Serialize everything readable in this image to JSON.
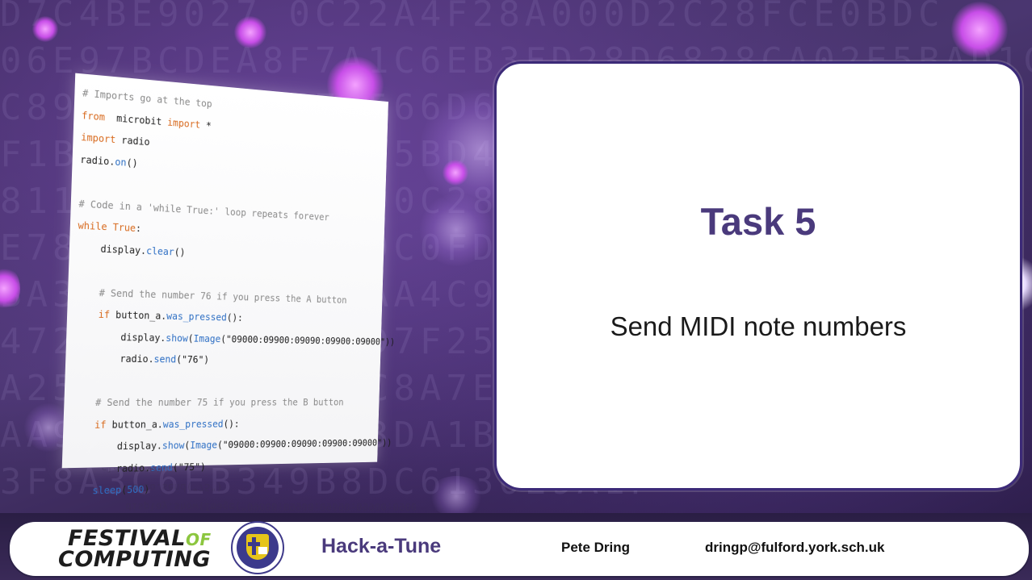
{
  "background": {
    "hex_rows": [
      "D7C4BE9027 0C22A4F28A000D2C28FCE0BDC",
      "06E97BCDEA8F7A1C6EB3FD28D6828CA02E5BAD1C6",
      "C89FB20D19A672566D6F9A9CCCCCA95DEB9AC",
      "F1BA63A2D7C4E585BD4F9A51A3CE67E11BB0",
      "811A5E62B0F1E9D0C28A8D9E2BC0F4A1",
      "E786F2B77C4A9D9C0FD3D2C8B6A4E8F",
      "BA3EA8B7D9E8B3AA4C9EB1F0C2DAE8",
      "472B8E3F9BD2A8D7F251ED9A8C6E2",
      "A25B4FC74EBA82C8A7E9C3B1A0D",
      "AA9B4F3F8C0E9D3DA1B2C6B4E",
      "3F8A3C6EB349B8DC6130E9A1F"
    ],
    "colors": {
      "bg_top": "#3c2a5c",
      "bg_bottom": "#1c1230",
      "orb": "#c84ee8"
    }
  },
  "code": {
    "lines": [
      [
        [
          "cm",
          "# Imports go at the top"
        ]
      ],
      [
        [
          "kw",
          "from"
        ],
        [
          "",
          "  microbit "
        ],
        [
          "kw",
          "import"
        ],
        [
          "",
          " *"
        ]
      ],
      [
        [
          "kw",
          "import"
        ],
        [
          "",
          " radio"
        ]
      ],
      [
        [
          "",
          "radio."
        ],
        [
          "fn",
          "on"
        ],
        [
          "",
          "()"
        ]
      ],
      [
        [
          "",
          ""
        ]
      ],
      [
        [
          "cm",
          "# Code in a 'while True:' loop repeats forever"
        ]
      ],
      [
        [
          "kw",
          "while"
        ],
        [
          "",
          " "
        ],
        [
          "kw",
          "True"
        ],
        [
          "",
          ":"
        ]
      ],
      [
        [
          "",
          "    display."
        ],
        [
          "fn",
          "clear"
        ],
        [
          "",
          "()"
        ]
      ],
      [
        [
          "",
          ""
        ]
      ],
      [
        [
          "cm",
          "    # Send the number 76 if you press the A button"
        ]
      ],
      [
        [
          "kw",
          "    if"
        ],
        [
          "",
          " button_a."
        ],
        [
          "fn",
          "was_pressed"
        ],
        [
          "",
          "():"
        ]
      ],
      [
        [
          "",
          "        display."
        ],
        [
          "fn",
          "show"
        ],
        [
          "",
          "("
        ],
        [
          "fn",
          "Image"
        ],
        [
          "st",
          "(\"09000:09900:09090:09900:09000\"))"
        ]
      ],
      [
        [
          "",
          "        radio."
        ],
        [
          "fn",
          "send"
        ],
        [
          "st",
          "(\"76\")"
        ]
      ],
      [
        [
          "",
          ""
        ]
      ],
      [
        [
          "cm",
          "    # Send the number 75 if you press the B button"
        ]
      ],
      [
        [
          "kw",
          "    if"
        ],
        [
          "",
          " button_a."
        ],
        [
          "fn",
          "was_pressed"
        ],
        [
          "",
          "():"
        ]
      ],
      [
        [
          "",
          "        display."
        ],
        [
          "fn",
          "show"
        ],
        [
          "",
          "("
        ],
        [
          "fn",
          "Image"
        ],
        [
          "st",
          "(\"09000:09900:09090:09900:09000\"))"
        ]
      ],
      [
        [
          "",
          "        radio."
        ],
        [
          "fn",
          "send"
        ],
        [
          "st",
          "(\"75\")"
        ]
      ],
      [
        [
          "fn",
          "    sleep"
        ],
        [
          "",
          "("
        ],
        [
          "fn",
          "500"
        ],
        [
          "",
          ")"
        ]
      ]
    ],
    "reflection_lines": [
      "    sleep(500)",
      "        radio.send(\"75\")",
      "        display.show(Image(\"09000:09900:09090:09900:09000\"))"
    ]
  },
  "task": {
    "title": "Task 5",
    "subtitle": "Send MIDI note numbers"
  },
  "footer": {
    "logo_line1_a": "FESTIVAL",
    "logo_line1_b": "OF",
    "logo_line2": "COMPUTING",
    "crest_name": "school-crest-icon",
    "hack_title": "Hack-a-Tune",
    "author": "Pete Dring",
    "email": "dringp@fulford.york.sch.uk"
  }
}
